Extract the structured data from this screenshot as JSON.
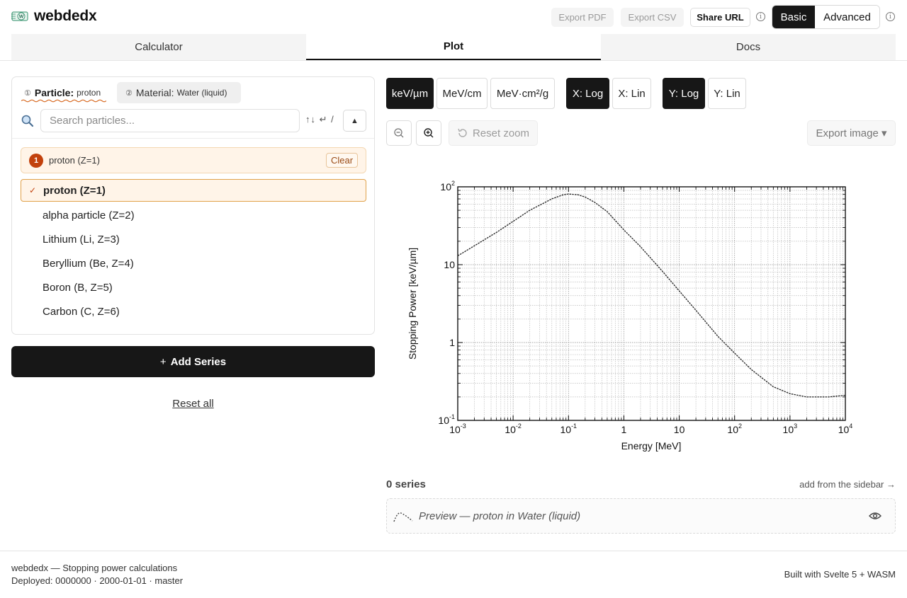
{
  "header": {
    "app_title": "webdedx",
    "logo_text": "W",
    "export_pdf": "Export PDF",
    "export_csv": "Export CSV",
    "share_url": "Share URL",
    "mode_basic": "Basic",
    "mode_advanced": "Advanced",
    "info_glyph": "i"
  },
  "nav": {
    "tabs": [
      {
        "label": "Calculator",
        "active": false
      },
      {
        "label": "Plot",
        "active": true
      },
      {
        "label": "Docs",
        "active": false
      }
    ]
  },
  "sidebar": {
    "particle_tab": {
      "number": "①",
      "key": "Particle:",
      "value": "proton"
    },
    "material_tab": {
      "number": "②",
      "key": "Material:",
      "value": "Water (liquid)"
    },
    "search": {
      "placeholder": "Search particles...",
      "value": ""
    },
    "kbd_hint": "↑↓ ↵ /",
    "collapse_glyph": "▲",
    "selected_banner": {
      "badge": "1",
      "text": "proton (Z=1)",
      "clear_label": "Clear"
    },
    "particles": [
      {
        "label": "proton (Z=1)",
        "selected": true
      },
      {
        "label": "alpha particle (Z=2)",
        "selected": false
      },
      {
        "label": "Lithium (Li, Z=3)",
        "selected": false
      },
      {
        "label": "Beryllium (Be, Z=4)",
        "selected": false
      },
      {
        "label": "Boron (B, Z=5)",
        "selected": false
      },
      {
        "label": "Carbon (C, Z=6)",
        "selected": false
      }
    ],
    "check_glyph": "✓",
    "add_series": {
      "plus": "+",
      "label": "Add Series"
    },
    "reset_all": "Reset all"
  },
  "plot_controls": {
    "units": [
      {
        "label": "keV/µm",
        "active": true
      },
      {
        "label": "MeV/cm",
        "active": false
      },
      {
        "label": "MeV·cm²/g",
        "active": false
      }
    ],
    "x_scale": [
      {
        "label": "X: Log",
        "active": true
      },
      {
        "label": "X: Lin",
        "active": false
      }
    ],
    "y_scale": [
      {
        "label": "Y: Log",
        "active": true
      },
      {
        "label": "Y: Lin",
        "active": false
      }
    ],
    "reset_zoom": "Reset zoom",
    "export_image": "Export image ▾"
  },
  "chart_data": {
    "type": "line",
    "xlabel": "Energy [MeV]",
    "ylabel": "Stopping Power [keV/µm]",
    "x_scale": "log",
    "y_scale": "log",
    "xlim": [
      0.001,
      10000
    ],
    "ylim": [
      0.1,
      100
    ],
    "x_ticks": [
      {
        "base": "10",
        "exp": "-3"
      },
      {
        "base": "10",
        "exp": "-2"
      },
      {
        "base": "10",
        "exp": "-1"
      },
      {
        "base": "1",
        "exp": ""
      },
      {
        "base": "10",
        "exp": ""
      },
      {
        "base": "10",
        "exp": "2"
      },
      {
        "base": "10",
        "exp": "3"
      },
      {
        "base": "10",
        "exp": "4"
      }
    ],
    "y_ticks": [
      {
        "base": "10",
        "exp": "-1"
      },
      {
        "base": "1",
        "exp": ""
      },
      {
        "base": "10",
        "exp": ""
      },
      {
        "base": "10",
        "exp": "2"
      }
    ],
    "grid": true,
    "series": [
      {
        "x": [
          0.001,
          0.002,
          0.005,
          0.01,
          0.02,
          0.05,
          0.08,
          0.1,
          0.15,
          0.2,
          0.3,
          0.5,
          1,
          2,
          5,
          10,
          20,
          50,
          100,
          200,
          500,
          1000,
          2000,
          5000,
          10000
        ],
        "y": [
          13,
          17.5,
          26,
          36,
          50,
          70,
          79,
          81,
          79,
          74,
          63,
          48,
          28,
          17,
          8.2,
          4.6,
          2.6,
          1.2,
          0.73,
          0.45,
          0.27,
          0.22,
          0.2,
          0.2,
          0.21
        ],
        "line_style": "dashed"
      }
    ]
  },
  "series_panel": {
    "count_label": "0 series",
    "hint": "add from the sidebar →",
    "preview_label": "Preview — proton in Water (liquid)"
  },
  "footer": {
    "line1": "webdedx — Stopping power calculations",
    "line2": "Deployed: 0000000 · 2000-01-01 · master",
    "built_with": "Built with Svelte 5 + WASM"
  }
}
